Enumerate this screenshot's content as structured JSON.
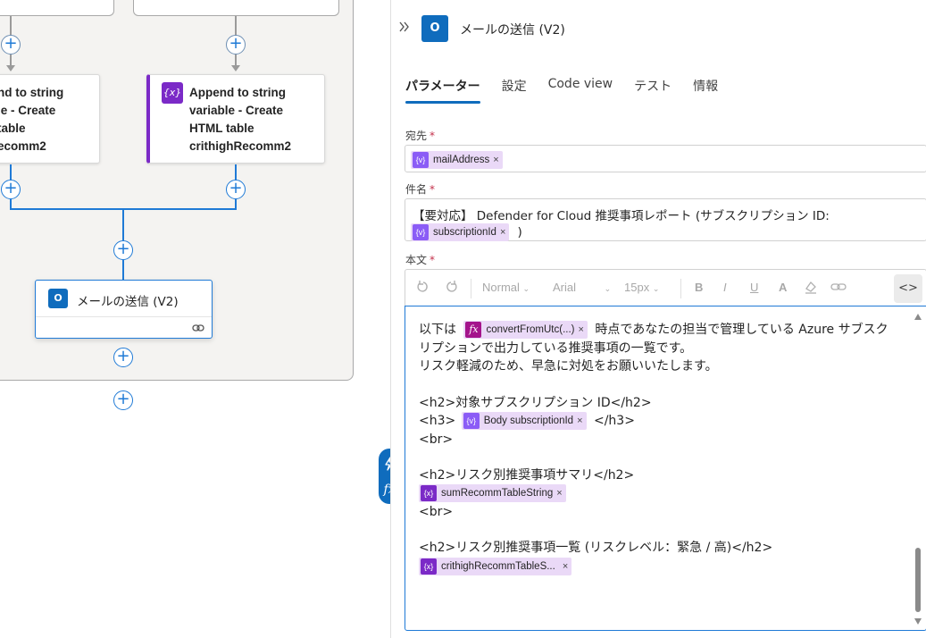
{
  "canvas": {
    "left_node_lines": [
      "nd to string",
      "le - Create",
      " table",
      "ecomm2"
    ],
    "right_node_lines": [
      "Append to string",
      "variable - Create",
      "HTML table",
      "crithighRecomm2"
    ],
    "var_icon": "{x}",
    "mail_node_title": "メールの送信 (V2)",
    "plus_symbol": "+"
  },
  "panel": {
    "title": "メールの送信 (V2)",
    "tabs": [
      "パラメーター",
      "設定",
      "Code view",
      "テスト",
      "情報"
    ],
    "to": {
      "label": "宛先",
      "required_mark": "*",
      "token": "mailAddress"
    },
    "subject": {
      "label": "件名",
      "required_mark": "*",
      "text": "【要対応】 Defender for Cloud 推奨事項レポート (サブスクリプション ID:",
      "token": "subscriptionId",
      "suffix": ")"
    },
    "body": {
      "label": "本文",
      "required_mark": "*",
      "toolbar": {
        "format": "Normal",
        "font": "Arial",
        "size": "15px",
        "bold": "B",
        "italic": "I",
        "underline": "U",
        "font_color": "A",
        "code_view": "<>"
      },
      "line1_prefix": "以下は",
      "line1_token": "convertFromUtc(...)",
      "line1_suffix": "時点であなたの担当で管理している Azure サブスク",
      "line2": "リプションで出力している推奨事項の一覧です。",
      "line3": "リスク軽減のため、早急に対処をお願いいたします。",
      "line5": "<h2>対象サブスクリプション ID</h2>",
      "line6_prefix": "<h3>",
      "line6_token": "Body subscriptionId",
      "line6_suffix": "</h3>",
      "line7": "<br>",
      "line9": "<h2>リスク別推奨事項サマリ</h2>",
      "line10_token": "sumRecommTableString",
      "line11": "<br>",
      "line13": "<h2>リスク別推奨事項一覧 (リスクレベル：緊急 / 高)</h2>",
      "line14_token": "crithighRecommTableS..."
    },
    "token_close": "×"
  },
  "colors": {
    "accent": "#0f6cbd",
    "flow_line": "#1f7ad6",
    "variable_purple": "#7b2ac7",
    "token_bg": "#ead9f7",
    "required": "#c4314b"
  },
  "icons": [
    "expand-icon",
    "outlook-icon",
    "variable-icon",
    "fx-icon",
    "undo-icon",
    "redo-icon",
    "highlight-icon",
    "link-icon",
    "lightning-icon",
    "code-view-icon"
  ]
}
